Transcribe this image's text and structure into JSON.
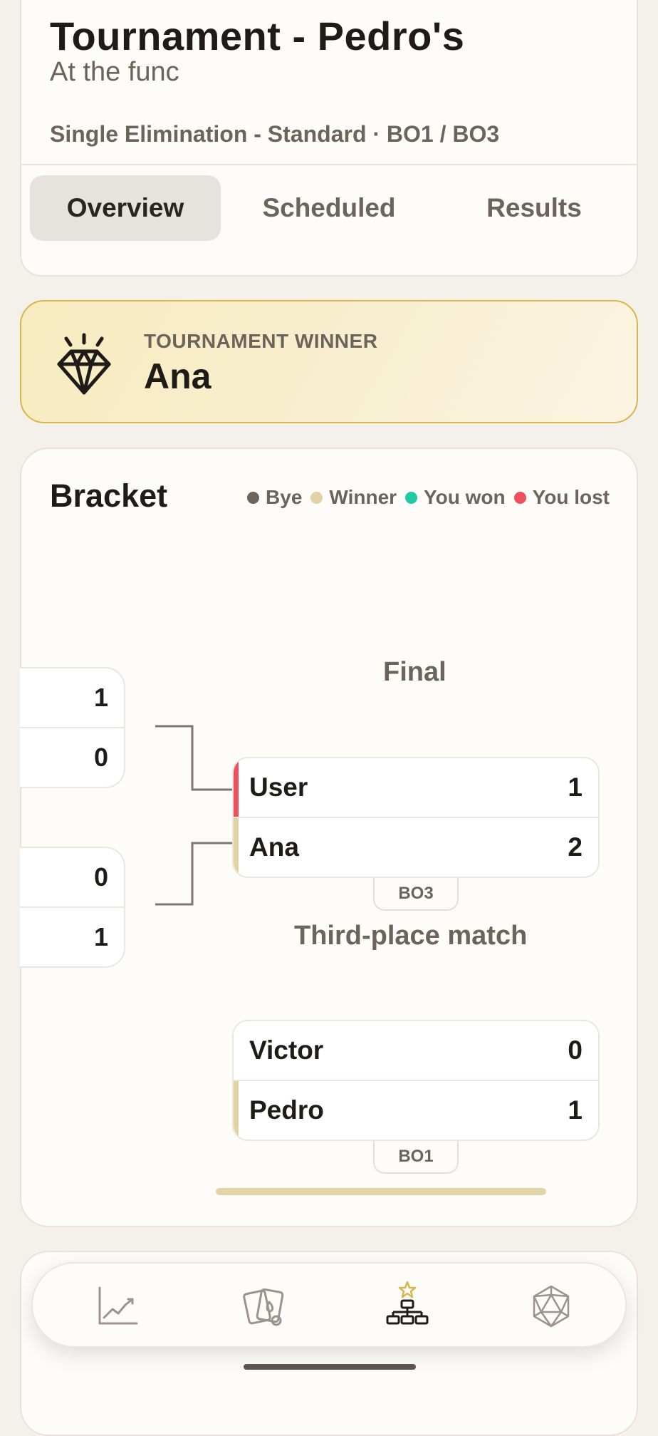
{
  "header": {
    "title": "Tournament - Pedro's",
    "subtitle": "At the func",
    "meta": "Single Elimination - Standard · BO1 / BO3",
    "tabs": [
      "Overview",
      "Scheduled",
      "Results"
    ],
    "active_tab": "Overview"
  },
  "winner": {
    "label": "TOURNAMENT WINNER",
    "name": "Ana",
    "icon": "diamond-icon"
  },
  "bracket": {
    "title": "Bracket",
    "legend": [
      {
        "label": "Bye",
        "color": "#6e645a"
      },
      {
        "label": "Winner",
        "color": "#e3d3a4"
      },
      {
        "label": "You won",
        "color": "#22c9a6"
      },
      {
        "label": "You lost",
        "color": "#ef4f5f"
      }
    ],
    "semifinal_scores": [
      {
        "top": "1",
        "bottom": "0"
      },
      {
        "top": "0",
        "bottom": "1"
      }
    ],
    "final": {
      "label": "Final",
      "players": [
        {
          "name": "User",
          "score": "1",
          "status": "lost"
        },
        {
          "name": "Ana",
          "score": "2",
          "status": "winner"
        }
      ],
      "format": "BO3"
    },
    "third_place": {
      "label": "Third-place match",
      "players": [
        {
          "name": "Victor",
          "score": "0",
          "status": "none"
        },
        {
          "name": "Pedro",
          "score": "1",
          "status": "winner"
        }
      ],
      "format": "BO1"
    }
  },
  "colors": {
    "winner": "#e3d3a4",
    "lost": "#ef4f5f",
    "won": "#22c9a6",
    "bye": "#6e645a",
    "accent_gold": "#d8b64f"
  },
  "bottom_nav": [
    {
      "icon": "chart-line-icon",
      "active": false
    },
    {
      "icon": "cards-icon",
      "active": false
    },
    {
      "icon": "bracket-icon",
      "active": true
    },
    {
      "icon": "d20-dice-icon",
      "active": false
    }
  ]
}
